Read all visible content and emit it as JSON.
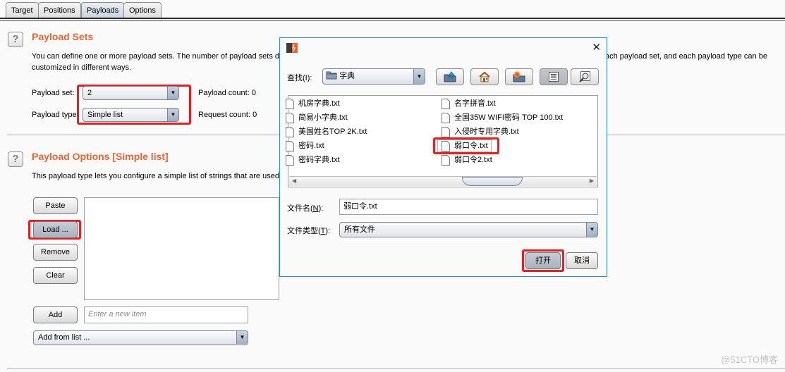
{
  "tabs": [
    {
      "label": "Target",
      "active": false
    },
    {
      "label": "Positions",
      "active": false
    },
    {
      "label": "Payloads",
      "active": true
    },
    {
      "label": "Options",
      "active": false
    }
  ],
  "payload_sets": {
    "help_icon": "?",
    "title": "Payload Sets",
    "description_line1": "You can define one or more payload sets. The number of payload sets d",
    "description_line1_right": "ach payload set, and each payload type can be",
    "description_line2": "customized in different ways.",
    "payload_set_label": "Payload set:",
    "payload_set_value": "2",
    "payload_type_label": "Payload type",
    "payload_type_value": "Simple list",
    "payload_count_label": "Payload count:",
    "payload_count_value": "0",
    "request_count_label": "Request count:",
    "request_count_value": "0"
  },
  "payload_options": {
    "help_icon": "?",
    "title": "Payload Options [Simple list]",
    "description": "This payload type lets you configure a simple list of strings that are used",
    "buttons": {
      "paste": "Paste",
      "load": "Load ...",
      "remove": "Remove",
      "clear": "Clear",
      "add": "Add"
    },
    "new_item_placeholder": "Enter a new item",
    "add_from_list": "Add from list ..."
  },
  "dialog": {
    "close_glyph": "✕",
    "look_in_label": "查找(I):",
    "folder": "字典",
    "toolbar": [
      "up-folder",
      "home",
      "new-folder",
      "list-view",
      "details-view"
    ],
    "files_left": [
      "机房字典.txt",
      "简易小字典.txt",
      "美国姓名TOP 2K.txt",
      "密码.txt",
      "密码字典.txt"
    ],
    "files_right": [
      "名字拼音.txt",
      "全国35W WIFI密码 TOP 100.txt",
      "入侵时专用字典.txt",
      "弱口令.txt",
      "弱口令2.txt"
    ],
    "selected_file": "弱口令.txt",
    "filename_label": "文件名(",
    "filename_mnemonic": "N",
    "filename_label_end": "):",
    "filename_value": "弱口令.txt",
    "filetype_label": "文件类型(",
    "filetype_mnemonic": "T",
    "filetype_label_end": "):",
    "filetype_value": "所有文件",
    "open_button": "打开",
    "cancel_button": "取消"
  },
  "watermark": "@51CTO博客",
  "colors": {
    "section_title": "#ef6234",
    "highlight": "#ee1c1c",
    "dialog_border": "#2b88d8"
  }
}
